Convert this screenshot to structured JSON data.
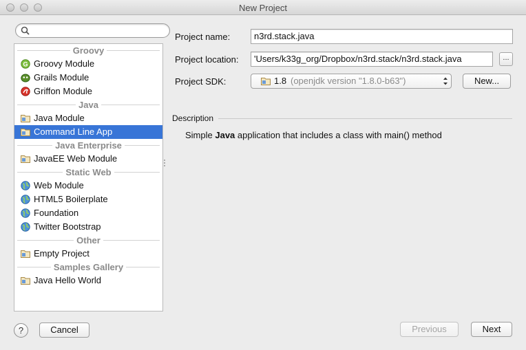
{
  "window": {
    "title": "New Project"
  },
  "search": {
    "value": "",
    "placeholder": ""
  },
  "groups": [
    {
      "header": "Groovy",
      "items": [
        {
          "label": "Groovy Module",
          "icon": "groovy-icon"
        },
        {
          "label": "Grails Module",
          "icon": "grails-icon"
        },
        {
          "label": "Griffon Module",
          "icon": "griffon-icon"
        }
      ]
    },
    {
      "header": "Java",
      "items": [
        {
          "label": "Java Module",
          "icon": "folder-icon"
        },
        {
          "label": "Command Line App",
          "icon": "folder-icon",
          "selected": true
        }
      ]
    },
    {
      "header": "Java Enterprise",
      "items": [
        {
          "label": "JavaEE Web Module",
          "icon": "folder-icon"
        }
      ]
    },
    {
      "header": "Static Web",
      "items": [
        {
          "label": "Web Module",
          "icon": "globe-icon"
        },
        {
          "label": "HTML5 Boilerplate",
          "icon": "globe-icon"
        },
        {
          "label": "Foundation",
          "icon": "globe-icon"
        },
        {
          "label": "Twitter Bootstrap",
          "icon": "globe-icon"
        }
      ]
    },
    {
      "header": "Other",
      "items": [
        {
          "label": "Empty Project",
          "icon": "folder-icon"
        }
      ]
    },
    {
      "header": "Samples Gallery",
      "items": [
        {
          "label": "Java Hello World",
          "icon": "folder-icon"
        }
      ]
    }
  ],
  "form": {
    "project_name_label": "Project name:",
    "project_name_value": "n3rd.stack.java",
    "project_location_label": "Project location:",
    "project_location_value": "'Users/k33g_org/Dropbox/n3rd.stack/n3rd.stack.java",
    "browse_label": "...",
    "project_sdk_label": "Project SDK:",
    "sdk_version": "1.8",
    "sdk_detail": "(openjdk version \"1.8.0-b63\")",
    "new_sdk_label": "New..."
  },
  "description": {
    "title": "Description",
    "text_before": "Simple ",
    "text_bold": "Java",
    "text_after": " application that includes a class with main() method"
  },
  "footer": {
    "help_label": "?",
    "cancel_label": "Cancel",
    "previous_label": "Previous",
    "next_label": "Next"
  },
  "colors": {
    "selection": "#3875d7",
    "group_header": "#8a8a8a",
    "window_bg": "#ececec"
  }
}
